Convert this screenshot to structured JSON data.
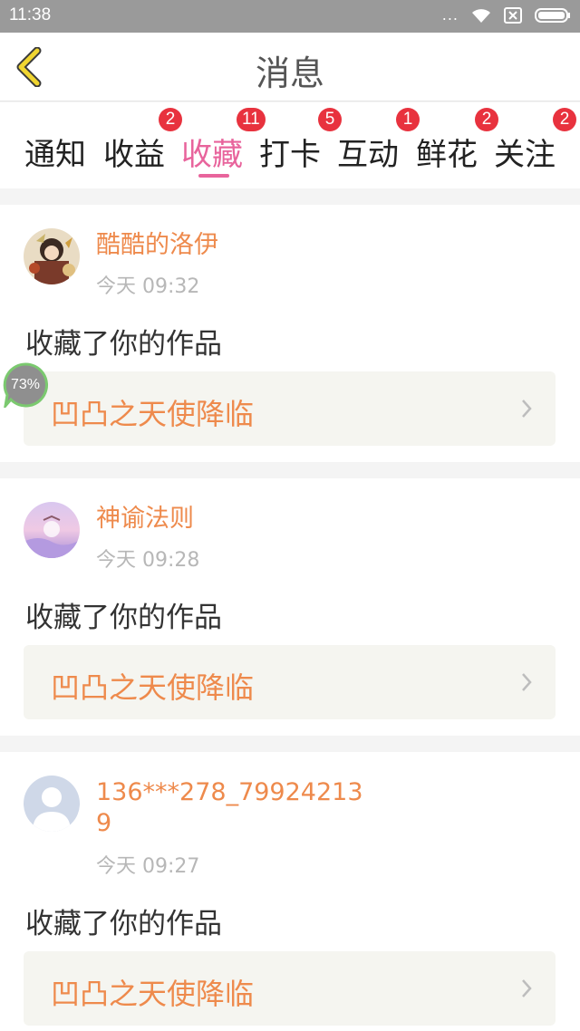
{
  "status_bar": {
    "time": "11:38",
    "dots": "...",
    "icons": [
      "wifi-icon",
      "sim-off-icon",
      "battery-icon"
    ]
  },
  "header": {
    "title": "消息",
    "back_icon": "chevron-left-icon"
  },
  "tabs": [
    {
      "label": "通知",
      "badge": ""
    },
    {
      "label": "收益",
      "badge": "2"
    },
    {
      "label": "收藏",
      "badge": "11",
      "active": true
    },
    {
      "label": "打卡",
      "badge": "5"
    },
    {
      "label": "互动",
      "badge": "1"
    },
    {
      "label": "鲜花",
      "badge": "2"
    },
    {
      "label": "关注",
      "badge": "2"
    }
  ],
  "messages": [
    {
      "username": "酷酷的洛伊",
      "time": "今天 09:32",
      "action": "收藏了你的作品",
      "work_title": "凹凸之天使降临",
      "avatar_icon": "anime-avatar-icon"
    },
    {
      "username": "神谕法则",
      "time": "今天 09:28",
      "action": "收藏了你的作品",
      "work_title": "凹凸之天使降临",
      "avatar_icon": "purple-sky-avatar-icon"
    },
    {
      "username": "136***278_799242139",
      "time": "今天 09:27",
      "action": "收藏了你的作品",
      "work_title": "凹凸之天使降临",
      "avatar_icon": "default-user-avatar-icon"
    }
  ],
  "floating_badge": {
    "text": "73%"
  },
  "colors": {
    "accent_pink": "#e8649c",
    "accent_orange": "#ee8a4c",
    "badge_red": "#e8323e",
    "back_yellow": "#f0d530"
  }
}
